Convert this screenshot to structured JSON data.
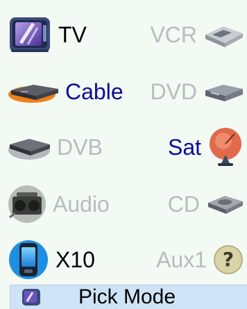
{
  "devices": [
    {
      "label": "TV",
      "icon": "tv-icon",
      "state": "selected"
    },
    {
      "label": "VCR",
      "icon": "vcr-icon",
      "state": "inactive"
    },
    {
      "label": "Cable",
      "icon": "cable-box-icon",
      "state": "active"
    },
    {
      "label": "DVD",
      "icon": "dvd-player-icon",
      "state": "inactive"
    },
    {
      "label": "DVB",
      "icon": "dvb-receiver-icon",
      "state": "inactive"
    },
    {
      "label": "Sat",
      "icon": "satellite-dish-icon",
      "state": "active"
    },
    {
      "label": "Audio",
      "icon": "audio-radio-icon",
      "state": "inactive"
    },
    {
      "label": "CD",
      "icon": "cd-player-icon",
      "state": "inactive"
    },
    {
      "label": "X10",
      "icon": "x10-remote-icon",
      "state": "selected"
    },
    {
      "label": "Aux1",
      "icon": "help-icon",
      "state": "inactive"
    }
  ],
  "status_bar": {
    "label": "Pick Mode",
    "icon": "tv-icon"
  },
  "colors": {
    "background": "#f3f9f3",
    "active_text": "#0b0b9a",
    "inactive_text": "#b8bcbe",
    "status_bar": "#cfe3f6"
  }
}
